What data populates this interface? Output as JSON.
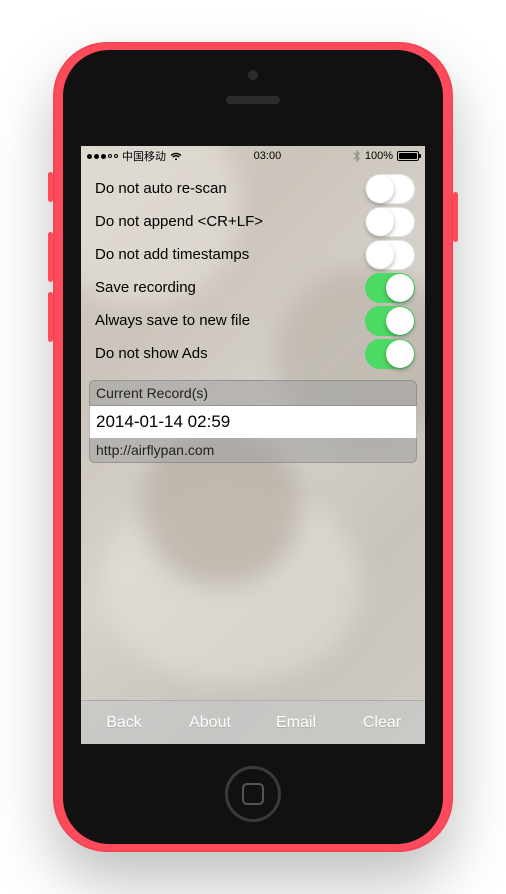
{
  "status": {
    "carrier": "中国移动",
    "time": "03:00",
    "battery_pct": "100%"
  },
  "settings": [
    {
      "label": "Do not auto re-scan",
      "on": false
    },
    {
      "label": "Do not append <CR+LF>",
      "on": false
    },
    {
      "label": "Do not add timestamps",
      "on": false
    },
    {
      "label": "Save recording",
      "on": true
    },
    {
      "label": "Always save to new file",
      "on": true
    },
    {
      "label": "Do not show Ads",
      "on": true
    }
  ],
  "records": {
    "header": "Current Record(s)",
    "item": "2014-01-14 02:59",
    "footer": "http://airflypan.com"
  },
  "toolbar": {
    "back": "Back",
    "about": "About",
    "email": "Email",
    "clear": "Clear"
  }
}
